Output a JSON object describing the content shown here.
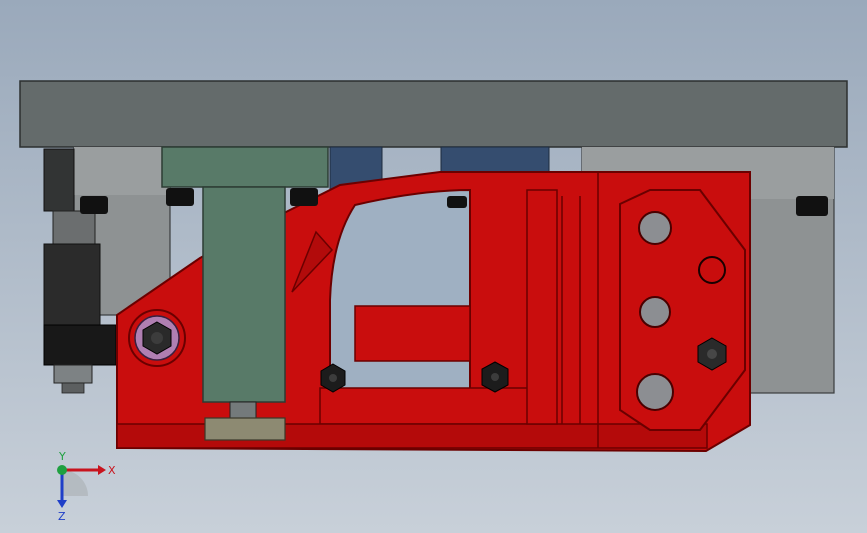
{
  "viewport": {
    "colors": {
      "background_top": "#9aa9bb",
      "background_bottom": "#c8d0d9",
      "top_plate": "#646b6b",
      "support_block": "#8e9293",
      "clamp_arm": "#c90d0d",
      "clamp_arm_dark": "#8f0606",
      "riser_block": "#587a68",
      "guide_bar": "#354d6f",
      "fastener": "#1a1a1a",
      "cylinder": "#2b2b2b",
      "pivot_washer": "#b07fb2"
    }
  },
  "triad": {
    "x_label": "X",
    "y_label": "Y",
    "z_label": "Z",
    "x_color": "#c8141e",
    "y_color": "#1fa040",
    "z_color": "#1f3fc8"
  }
}
